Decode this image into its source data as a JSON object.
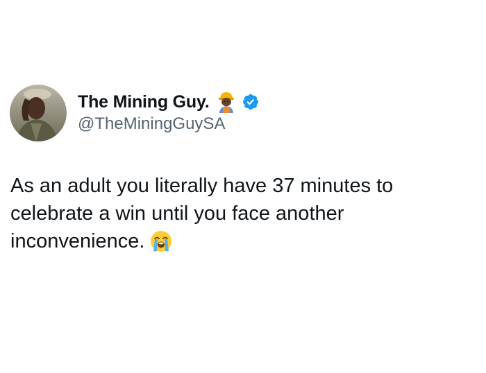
{
  "author": {
    "display_name": "The Mining Guy.",
    "name_emoji": "construction-worker-emoji",
    "verified": true,
    "handle": "@TheMiningGuySA"
  },
  "tweet": {
    "lines": [
      "As an adult you literally have 37 minutes to",
      "celebrate a win until you face another",
      "inconvenience."
    ],
    "trailing_emoji": "loudly-crying-face-emoji"
  },
  "colors": {
    "background": "#ffffff",
    "text": "#0f1419",
    "secondary_text": "#536471",
    "verified_badge": "#1d9bf0"
  }
}
